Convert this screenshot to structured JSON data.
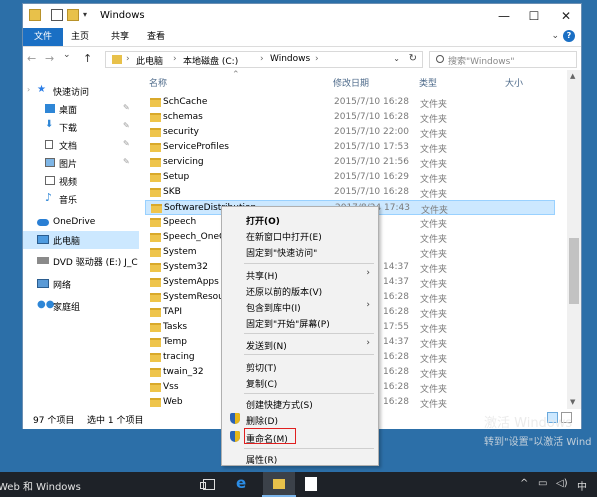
{
  "window": {
    "title": "Windows",
    "controls": {
      "minimize": "—",
      "maximize": "☐",
      "close": "✕"
    },
    "quick_access_arrow": "▾"
  },
  "ribbon": {
    "tabs": [
      "文件",
      "主页",
      "共享",
      "查看"
    ],
    "collapse": "⌄",
    "help": "?"
  },
  "navigation": {
    "back": "←",
    "forward": "→",
    "dropdown": "⌄",
    "up": "↑",
    "breadcrumb": [
      "此电脑",
      "本地磁盘 (C:)",
      "Windows"
    ],
    "separator": "›",
    "caret": "⌄",
    "refresh": "↻",
    "search_placeholder": "搜索\"Windows\""
  },
  "sidebar": {
    "items": [
      {
        "label": "快速访问",
        "icon": "star-icon",
        "pinned": false
      },
      {
        "label": "桌面",
        "icon": "desktop-icon",
        "pinned": true
      },
      {
        "label": "下载",
        "icon": "download-icon",
        "pinned": true
      },
      {
        "label": "文档",
        "icon": "document-icon",
        "pinned": true
      },
      {
        "label": "图片",
        "icon": "picture-icon",
        "pinned": true
      },
      {
        "label": "视频",
        "icon": "video-icon",
        "pinned": false
      },
      {
        "label": "音乐",
        "icon": "music-icon",
        "pinned": false
      },
      {
        "label": "OneDrive",
        "icon": "cloud-icon",
        "pinned": false
      },
      {
        "label": "此电脑",
        "icon": "computer-icon",
        "pinned": false,
        "selected": true
      },
      {
        "label": "DVD 驱动器 (E:) J_C",
        "icon": "dvd-icon",
        "pinned": false
      },
      {
        "label": "网络",
        "icon": "network-icon",
        "pinned": false
      },
      {
        "label": "家庭组",
        "icon": "homegroup-icon",
        "pinned": false
      }
    ],
    "pin_glyph": "✎",
    "expand_glyph": "›"
  },
  "columns": {
    "name": "名称",
    "modified": "修改日期",
    "type": "类型",
    "size": "大小",
    "sort_caret": "⌃"
  },
  "files": [
    {
      "name": "SchCache",
      "date": "2015/7/10 16:28",
      "type": "文件夹"
    },
    {
      "name": "schemas",
      "date": "2015/7/10 16:28",
      "type": "文件夹"
    },
    {
      "name": "security",
      "date": "2015/7/10 22:00",
      "type": "文件夹"
    },
    {
      "name": "ServiceProfiles",
      "date": "2015/7/10 17:53",
      "type": "文件夹"
    },
    {
      "name": "servicing",
      "date": "2015/7/10 21:56",
      "type": "文件夹"
    },
    {
      "name": "Setup",
      "date": "2015/7/10 16:29",
      "type": "文件夹"
    },
    {
      "name": "SKB",
      "date": "2015/7/10 16:28",
      "type": "文件夹"
    },
    {
      "name": "SoftwareDistribution",
      "date": "2017/8/24 17:43",
      "type": "文件夹",
      "selected": true
    },
    {
      "name": "Speech",
      "date": "",
      "type": "文件夹"
    },
    {
      "name": "Speech_OneCo",
      "date": "",
      "type": "文件夹"
    },
    {
      "name": "System",
      "date": "",
      "type": "文件夹"
    },
    {
      "name": "System32",
      "date": "14:37",
      "type": "文件夹"
    },
    {
      "name": "SystemApps",
      "date": "14:37",
      "type": "文件夹"
    },
    {
      "name": "SystemResour",
      "date": "16:28",
      "type": "文件夹"
    },
    {
      "name": "TAPI",
      "date": "16:28",
      "type": "文件夹"
    },
    {
      "name": "Tasks",
      "date": "17:55",
      "type": "文件夹"
    },
    {
      "name": "Temp",
      "date": "14:37",
      "type": "文件夹"
    },
    {
      "name": "tracing",
      "date": "16:28",
      "type": "文件夹"
    },
    {
      "name": "twain_32",
      "date": "16:28",
      "type": "文件夹"
    },
    {
      "name": "Vss",
      "date": "16:28",
      "type": "文件夹"
    },
    {
      "name": "Web",
      "date": "16:28",
      "type": "文件夹"
    }
  ],
  "context_menu": {
    "items": [
      {
        "label": "打开(O)",
        "bold": true
      },
      {
        "label": "在新窗口中打开(E)"
      },
      {
        "label": "固定到\"快速访问\""
      },
      {
        "label": "共享(H)",
        "submenu": true
      },
      {
        "label": "还原以前的版本(V)"
      },
      {
        "label": "包含到库中(I)",
        "submenu": true
      },
      {
        "label": "固定到\"开始\"屏幕(P)"
      },
      {
        "label": "发送到(N)",
        "submenu": true
      },
      {
        "label": "剪切(T)"
      },
      {
        "label": "复制(C)"
      },
      {
        "label": "创建快捷方式(S)"
      },
      {
        "label": "删除(D)",
        "shield": true
      },
      {
        "label": "重命名(M)",
        "shield": true,
        "highlighted": true
      },
      {
        "label": "属性(R)"
      }
    ],
    "submenu_glyph": "›"
  },
  "status": {
    "item_count": "97 个项目",
    "selected": "选中 1 个项目"
  },
  "watermark": {
    "line1": "激活 Windows",
    "line2": "转到\"设置\"以激活 Wind"
  },
  "taskbar": {
    "search_text": "Web 和 Windows",
    "system": {
      "up_arrow": "^",
      "network": "▭",
      "volume": "◁)",
      "ime": "中"
    }
  },
  "colors": {
    "accent": "#1a6fc4",
    "selection": "#cce8ff",
    "highlight_box": "#e02020",
    "taskbar": "#1e2228"
  }
}
